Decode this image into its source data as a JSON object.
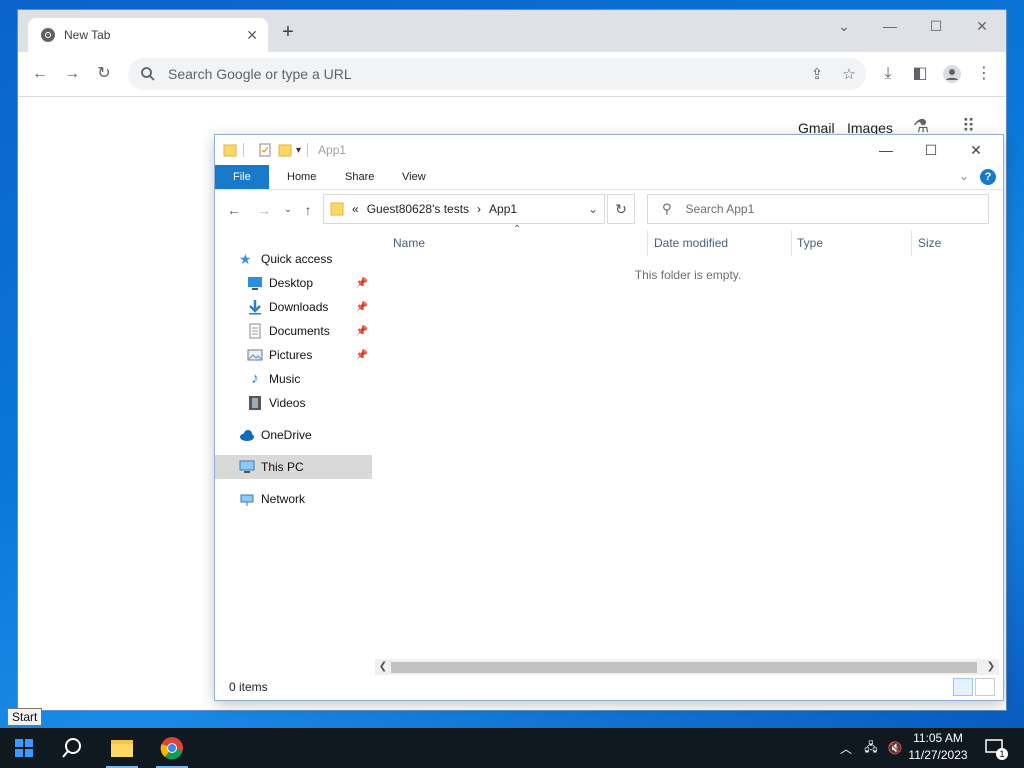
{
  "chrome": {
    "tab_title": "New Tab",
    "omnibox_placeholder": "Search Google or type a URL",
    "ntp_gmail": "Gmail",
    "ntp_images": "Images"
  },
  "explorer": {
    "title": "App1",
    "ribbon_tabs": [
      "File",
      "Home",
      "Share",
      "View"
    ],
    "breadcrumb": [
      "«",
      "Guest80628's tests",
      "›",
      "App1"
    ],
    "search_placeholder": "Search App1",
    "nav": [
      {
        "label": "Quick access",
        "icon": "star-icon"
      },
      {
        "label": "Desktop",
        "icon": "desktop-icon",
        "pinned": true
      },
      {
        "label": "Downloads",
        "icon": "download-icon",
        "pinned": true
      },
      {
        "label": "Documents",
        "icon": "documents-icon",
        "pinned": true
      },
      {
        "label": "Pictures",
        "icon": "pictures-icon",
        "pinned": true
      },
      {
        "label": "Music",
        "icon": "music-icon"
      },
      {
        "label": "Videos",
        "icon": "videos-icon"
      },
      {
        "label": "OneDrive",
        "icon": "cloud-icon"
      },
      {
        "label": "This PC",
        "icon": "computer-icon",
        "selected": true
      },
      {
        "label": "Network",
        "icon": "network-icon"
      }
    ],
    "columns": [
      "Name",
      "Date modified",
      "Type",
      "Size"
    ],
    "empty_message": "This folder is empty.",
    "status": "0 items"
  },
  "taskbar": {
    "start_tooltip": "Start",
    "time": "11:05 AM",
    "date": "11/27/2023",
    "notification_count": "1"
  },
  "colors": {
    "file_tab": "#1979ca",
    "selection": "#d9d9d9",
    "taskbar": "#101820"
  }
}
